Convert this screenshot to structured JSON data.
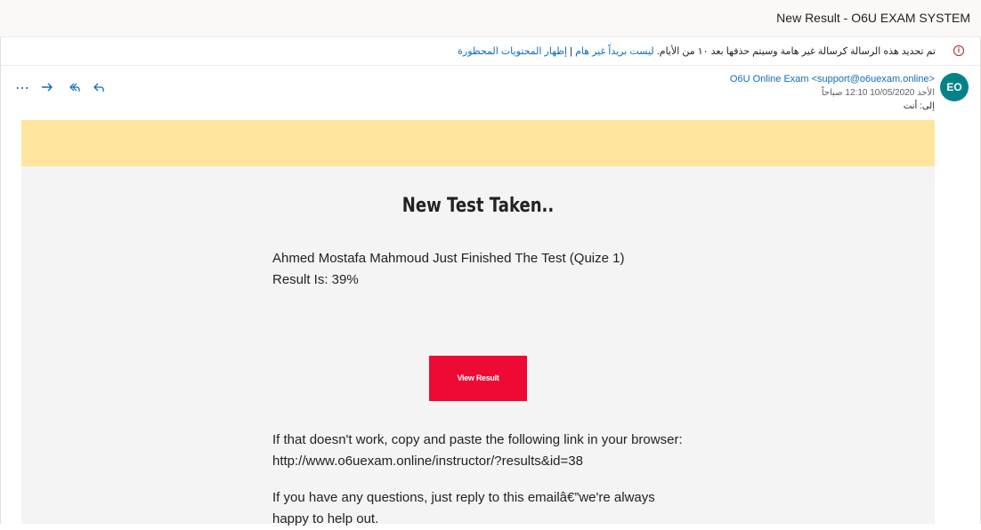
{
  "window": {
    "title": "New Result - O6U EXAM SYSTEM"
  },
  "notice": {
    "icon": "info-circle-icon",
    "text": "تم تحديد هذه الرسالة كرسالة غير هامة وسيتم حذفها بعد ١٠ من الأيام.",
    "not_junk_link": "ليست بريداً غير هام",
    "separator": "|",
    "show_blocked_link": "إظهار المحتويات المحظورة"
  },
  "message": {
    "avatar_initials": "EO",
    "avatar_color": "#038387",
    "sender": "O6U Online Exam <support@o6uexam.online>",
    "date": "الأحد 10/05/2020 12:10 صباحاً",
    "to_label": "إلى:",
    "to_value": "أنت",
    "actions": [
      "reply-icon",
      "reply-all-icon",
      "forward-icon",
      "more-icon"
    ]
  },
  "email": {
    "band_color": "#ffe59e",
    "heading": "New Test Taken..",
    "line1": "Ahmed Mostafa Mahmoud Just Finished The Test (Quize 1)",
    "line2": "Result Is: 39%",
    "button_label": "View Result",
    "button_color": "#ee0a34",
    "fallback_text": "If that doesn't work, copy and paste the following link in your browser: http://www.o6uexam.online/instructor/?results&id=38",
    "questions_text": "If you have any questions, just reply to this emailâ€”we're always happy to help out."
  }
}
